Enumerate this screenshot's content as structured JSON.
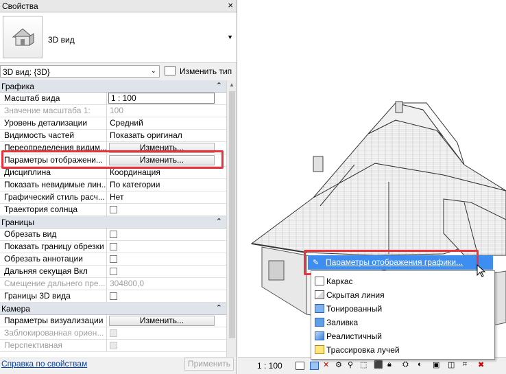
{
  "panel": {
    "title": "Свойства",
    "close": "×",
    "type_name": "3D вид",
    "view_selector": "3D вид: {3D}",
    "edit_type": "Изменить тип",
    "categories": [
      {
        "label": "Графика",
        "rows": [
          {
            "key": "Масштаб вида",
            "value": "1 : 100",
            "kind": "input"
          },
          {
            "key": "Значение масштаба    1:",
            "value": "100",
            "kind": "text",
            "disabled": true
          },
          {
            "key": "Уровень детализации",
            "value": "Средний",
            "kind": "text"
          },
          {
            "key": "Видимость частей",
            "value": "Показать оригинал",
            "kind": "text"
          },
          {
            "key": "Переопределения видим...",
            "value": "Изменить...",
            "kind": "button"
          },
          {
            "key": "Параметры отображени...",
            "value": "Изменить...",
            "kind": "button"
          },
          {
            "key": "Дисциплина",
            "value": "Координация",
            "kind": "text"
          },
          {
            "key": "Показать невидимые лин...",
            "value": "По категории",
            "kind": "text"
          },
          {
            "key": "Графический стиль расч...",
            "value": "Нет",
            "kind": "text"
          },
          {
            "key": "Траектория солнца",
            "value": "",
            "kind": "checkbox"
          }
        ]
      },
      {
        "label": "Границы",
        "rows": [
          {
            "key": "Обрезать вид",
            "value": "",
            "kind": "checkbox"
          },
          {
            "key": "Показать границу обрезки",
            "value": "",
            "kind": "checkbox"
          },
          {
            "key": "Обрезать аннотации",
            "value": "",
            "kind": "checkbox"
          },
          {
            "key": "Дальняя секущая Вкл",
            "value": "",
            "kind": "checkbox"
          },
          {
            "key": "Смещение дальнего пре...",
            "value": "304800,0",
            "kind": "text",
            "disabled": true
          },
          {
            "key": "Границы 3D вида",
            "value": "",
            "kind": "checkbox"
          }
        ]
      },
      {
        "label": "Камера",
        "rows": [
          {
            "key": "Параметры визуализации",
            "value": "Изменить...",
            "kind": "button"
          },
          {
            "key": "Заблокированная ориен...",
            "value": "",
            "kind": "checkbox",
            "disabled": true
          },
          {
            "key": "Перспективная",
            "value": "",
            "kind": "checkbox",
            "disabled": true
          }
        ]
      }
    ],
    "help_link": "Справка по свойствам",
    "apply": "Применить"
  },
  "status": {
    "scale": "1 : 100"
  },
  "popup": {
    "header": "Параметры отображения графики...",
    "items": [
      {
        "label": "Каркас",
        "icon": "wireframe-icon"
      },
      {
        "label": "Скрытая линия",
        "icon": "hidden-line-icon"
      },
      {
        "label": "Тонированный",
        "icon": "shaded-icon"
      },
      {
        "label": "Заливка",
        "icon": "consistent-colors-icon"
      },
      {
        "label": "Реалистичный",
        "icon": "realistic-icon"
      },
      {
        "label": "Трассировка лучей",
        "icon": "ray-trace-icon"
      }
    ]
  },
  "colors": {
    "highlight": "#3d8ef0",
    "annotation": "#e8323c",
    "category": "#dfe4ea"
  }
}
